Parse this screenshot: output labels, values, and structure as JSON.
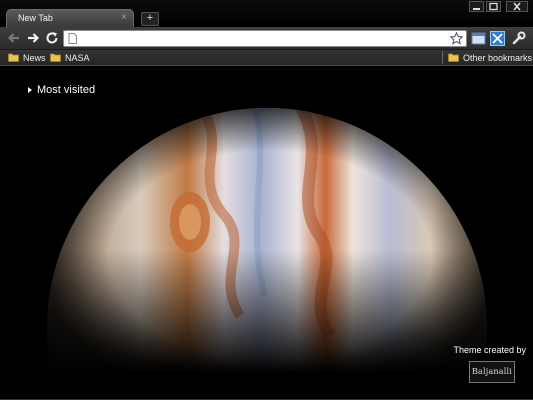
{
  "tab": {
    "title": "New Tab"
  },
  "bookmarks": {
    "items": [
      {
        "label": "News"
      },
      {
        "label": "NASA"
      }
    ],
    "other_label": "Other bookmarks"
  },
  "omnibox": {
    "value": ""
  },
  "content": {
    "most_visited_label": "Most visited",
    "theme_credit": "Theme created by",
    "author_logo_text": "Baljanalli"
  },
  "icons": {
    "back": "back-arrow-icon",
    "forward": "forward-arrow-icon",
    "reload": "reload-icon",
    "star": "star-icon",
    "page": "page-icon",
    "wrench": "wrench-icon",
    "minimize": "minimize-icon",
    "maximize": "maximize-icon",
    "close": "close-icon"
  },
  "colors": {
    "background": "#000000",
    "toolbar": "#333333",
    "omnibox": "#ffffff"
  }
}
